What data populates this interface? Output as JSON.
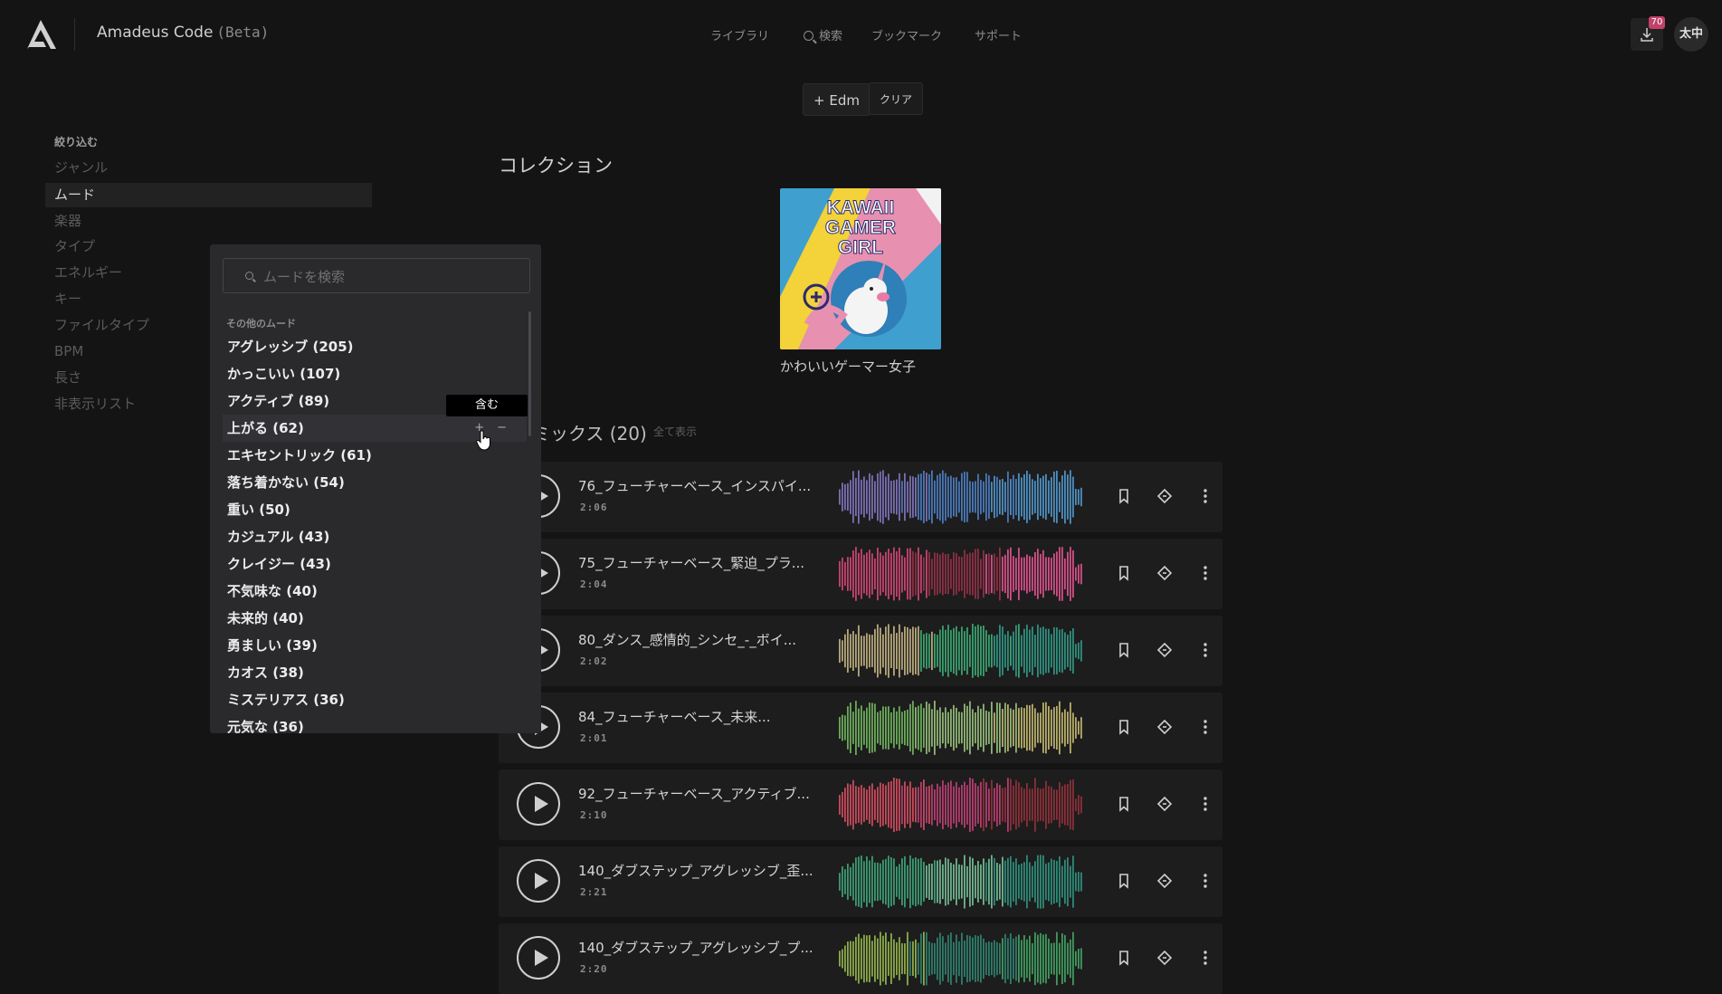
{
  "header": {
    "app_name": "Amadeus Code",
    "app_suffix": "(Beta)",
    "nav": {
      "library": "ライブラリ",
      "search": "検索",
      "bookmarks": "ブックマーク",
      "support": "サポート"
    },
    "download_badge": "70",
    "avatar_initials": "太中"
  },
  "filters": {
    "active_chip": "+ Edm",
    "clear_label": "クリア"
  },
  "sidebar": {
    "heading": "絞り込む",
    "items": [
      {
        "label": "ジャンル",
        "active": false
      },
      {
        "label": "ムード",
        "active": true
      },
      {
        "label": "楽器",
        "active": false
      },
      {
        "label": "タイプ",
        "active": false
      },
      {
        "label": "エネルギー",
        "active": false
      },
      {
        "label": "キー",
        "active": false
      },
      {
        "label": "ファイルタイプ",
        "active": false
      },
      {
        "label": "BPM",
        "active": false
      },
      {
        "label": "長さ",
        "active": false
      },
      {
        "label": "非表示リスト",
        "active": false
      }
    ]
  },
  "mood_dropdown": {
    "search_placeholder": "ムードを検索",
    "section_label": "その他のムード",
    "items": [
      "アグレッシブ (205)",
      "かっこいい (107)",
      "アクティブ (89)",
      "上がる (62)",
      "エキセントリック (61)",
      "落ち着かない (54)",
      "重い (50)",
      "カジュアル (43)",
      "クレイジー (43)",
      "不気味な (40)",
      "未来的 (40)",
      "勇ましい (39)",
      "カオス (38)",
      "ミステリアス (36)",
      "元気な (36)"
    ],
    "include_symbol": "+",
    "exclude_symbol": "−",
    "tooltip": "含む"
  },
  "collection": {
    "heading": "コレクション",
    "cover_text": "KAWAII GAMER GIRL",
    "caption": "かわいいゲーマー女子"
  },
  "mixes": {
    "heading": "ミックス (20)",
    "show_all": "全て表示",
    "tracks": [
      {
        "title": "76_フューチャーベース_インスパイ...",
        "duration": "2:06",
        "colors": [
          "#7a6fb3",
          "#4a78b8",
          "#4d8fc0"
        ]
      },
      {
        "title": "75_フューチャーベース_緊迫_プラ...",
        "duration": "2:04",
        "colors": [
          "#c4446e",
          "#8c2f45",
          "#d34f87"
        ]
      },
      {
        "title": "80_ダンス_感情的_シンセ_-_ボイ...",
        "duration": "2:02",
        "colors": [
          "#b6a77a",
          "#3aa06e",
          "#2f8f7e"
        ]
      },
      {
        "title": "84_フューチャーベース_未来...",
        "duration": "2:01",
        "colors": [
          "#6bab5a",
          "#8fb575",
          "#b8ae6a"
        ]
      },
      {
        "title": "92_フューチャーベース_アクティブ...",
        "duration": "2:10",
        "colors": [
          "#c94a5c",
          "#b33d6e",
          "#8a2f38"
        ]
      },
      {
        "title": "140_ダブステップ_アグレッシブ_歪...",
        "duration": "2:21",
        "colors": [
          "#3c9a73",
          "#6fb38e",
          "#2d8a78"
        ]
      },
      {
        "title": "140_ダブステップ_アグレッシブ_プ...",
        "duration": "2:20",
        "colors": [
          "#8bab4a",
          "#2f7d6a",
          "#3f9a5e"
        ]
      }
    ]
  },
  "icons": {
    "logo": "amadeus-logo-icon",
    "download": "download-icon",
    "bookmark": "bookmark-icon",
    "similar": "diamond-icon",
    "more": "more-vertical-icon"
  }
}
